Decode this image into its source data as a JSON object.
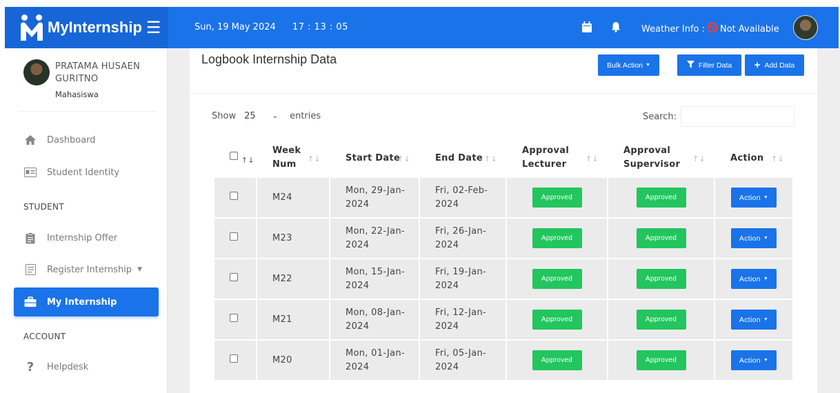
{
  "topbar": {
    "brand": "MyInternship",
    "date": "Sun, 19 May 2024",
    "time": "17 : 13 : 05",
    "weather_label": "Weather Info :",
    "weather_value": "Not Available",
    "icons": [
      "calendar-icon",
      "bell-icon",
      "no-entry-icon"
    ],
    "accent": "#1a73e8"
  },
  "sidebar": {
    "profile": {
      "name": "PRATAMA HUSAEN GURITNO",
      "role": "Mahasiswa"
    },
    "items": [
      {
        "label": "Dashboard",
        "icon": "home-icon"
      },
      {
        "label": "Student Identity",
        "icon": "id-card-icon"
      }
    ],
    "section_student": "STUDENT",
    "student_items": [
      {
        "label": "Internship Offer",
        "icon": "clipboard-icon"
      },
      {
        "label": "Register Internship",
        "icon": "form-icon"
      },
      {
        "label": "My Internship",
        "icon": "briefcase-icon",
        "active": true
      }
    ],
    "section_account": "ACCOUNT",
    "account_items": [
      {
        "label": "Helpdesk",
        "icon": "question-icon"
      }
    ]
  },
  "main": {
    "title": "Logbook Internship Data",
    "buttons": {
      "bulk": "Bulk Action",
      "filter": "Filter Data",
      "add": "Add Data"
    },
    "show_label": "Show",
    "entries_value": "25",
    "entries_label": "entries",
    "search_label": "Search:",
    "columns": [
      "Week Num",
      "Start Date",
      "End Date",
      "Approval Lecturer",
      "Approval Supervisor",
      "Action"
    ],
    "rows": [
      {
        "week": "M24",
        "start": "Mon, 29-Jan-2024",
        "end": "Fri, 02-Feb-2024",
        "lecturer": "Approved",
        "supervisor": "Approved",
        "action": "Action"
      },
      {
        "week": "M23",
        "start": "Mon, 22-Jan-2024",
        "end": "Fri, 26-Jan-2024",
        "lecturer": "Approved",
        "supervisor": "Approved",
        "action": "Action"
      },
      {
        "week": "M22",
        "start": "Mon, 15-Jan-2024",
        "end": "Fri, 19-Jan-2024",
        "lecturer": "Approved",
        "supervisor": "Approved",
        "action": "Action"
      },
      {
        "week": "M21",
        "start": "Mon, 08-Jan-2024",
        "end": "Fri, 12-Jan-2024",
        "lecturer": "Approved",
        "supervisor": "Approved",
        "action": "Action"
      },
      {
        "week": "M20",
        "start": "Mon, 01-Jan-2024",
        "end": "Fri, 05-Jan-2024",
        "lecturer": "Approved",
        "supervisor": "Approved",
        "action": "Action"
      }
    ],
    "approved_color": "#22c55e"
  }
}
